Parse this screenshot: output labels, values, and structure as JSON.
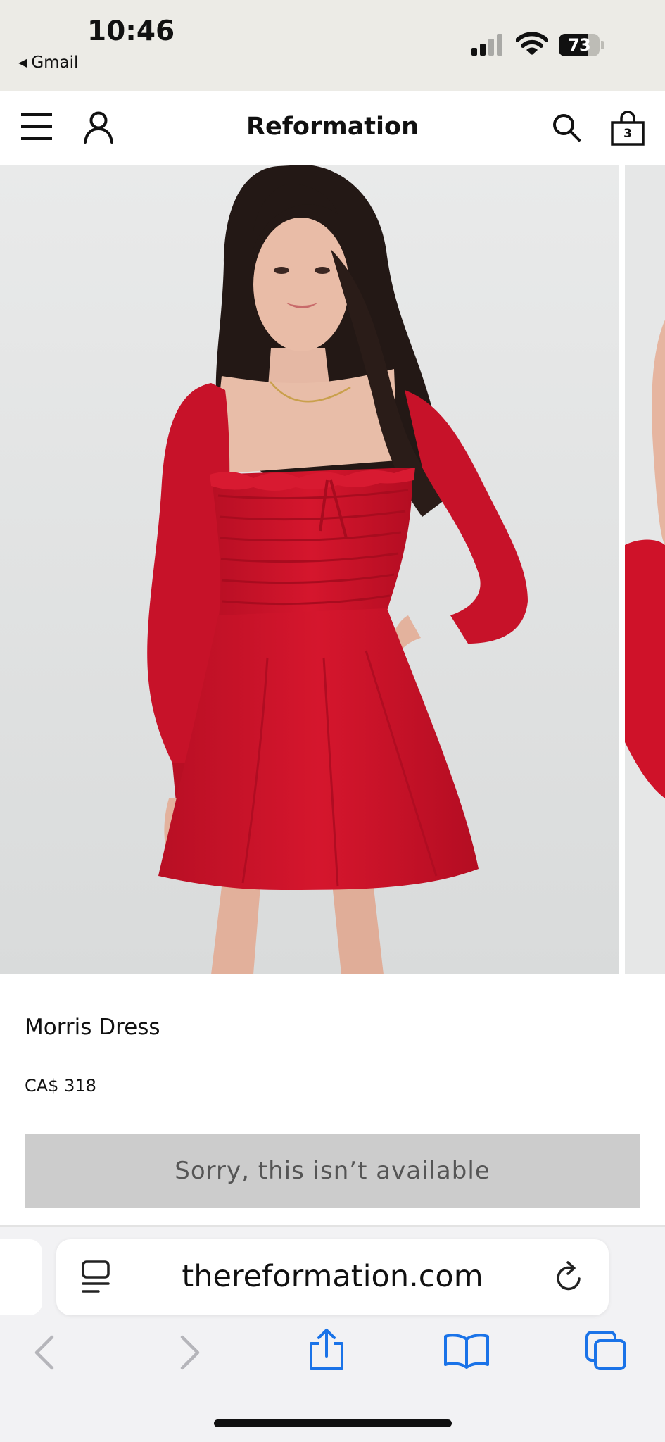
{
  "status_bar": {
    "time": "10:46",
    "back_app": "Gmail",
    "battery": "73",
    "battery_level": 0.73
  },
  "header": {
    "logo": "Reformation",
    "bag_count": "3"
  },
  "product": {
    "name": "Morris Dress",
    "price": "CA$ 318",
    "unavailable_label": "Sorry, this isn’t available",
    "dress_color": "#d0142a"
  },
  "browser": {
    "url": "thereformation.com",
    "accent": "#1a73e8"
  }
}
